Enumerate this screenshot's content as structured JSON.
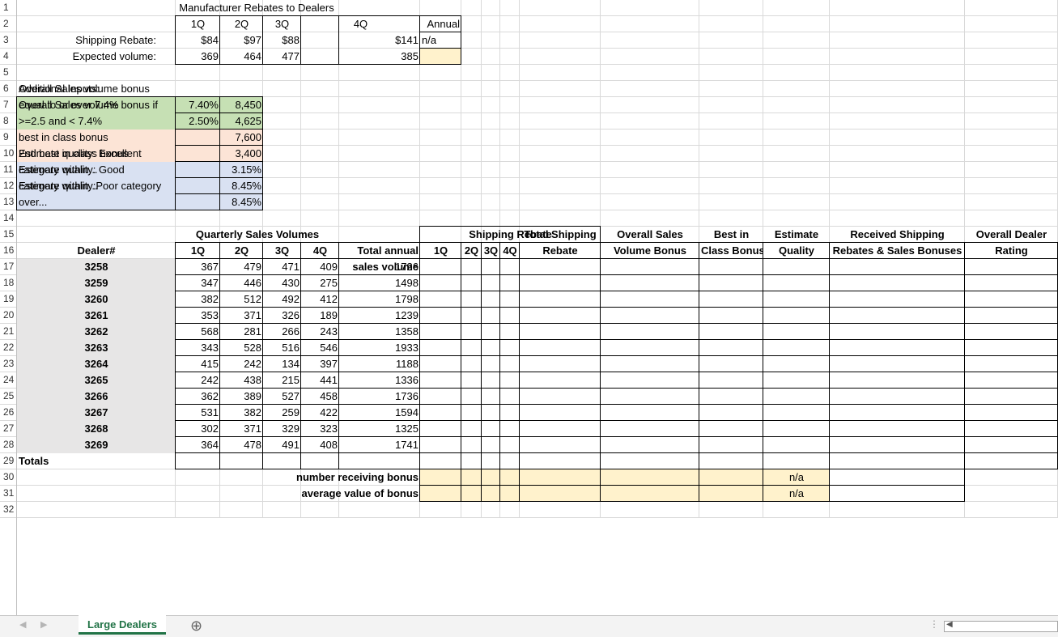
{
  "sheet": {
    "title": "Manufacturer Rebates to Dealers",
    "quarters": [
      "1Q",
      "2Q",
      "3Q",
      "4Q"
    ],
    "annual_label": "Annual",
    "shipping_rebate": {
      "label": "Shipping Rebate:",
      "values": [
        "$84",
        "$97",
        "$88",
        "$141"
      ],
      "annual": "n/a"
    },
    "expected_volume": {
      "label": "Expected volume:",
      "values": [
        "369",
        "464",
        "477",
        "385"
      ]
    },
    "additional_inputs_label": "Additional Inputs:",
    "inputs": [
      {
        "line1": "Overall Sales volume bonus",
        "line2": "equal to or over 7.4%",
        "pct": "7.40%",
        "value": "8,450"
      },
      {
        "line1": "Overall Sales volume bonus if",
        "line2": ">=2.5 and < 7.4%",
        "pct": "2.50%",
        "value": "4,625"
      },
      {
        "line1": "best in class bonus",
        "line2": "",
        "pct": "",
        "value": "7,600"
      },
      {
        "line1": "2nd best in class bonus",
        "line2": "",
        "pct": "",
        "value": "3,400"
      },
      {
        "line1": "Estimate quality: Excellent",
        "line2": "category within...",
        "pct": "",
        "value": "3.15%"
      },
      {
        "line1": "Estimate quality: Good",
        "line2": "category within...",
        "pct": "",
        "value": "8.45%"
      },
      {
        "line1": "Estimate quality:Poor category",
        "line2": "over...",
        "pct": "",
        "value": "8.45%"
      }
    ],
    "quarterly_sales_header": "Quarterly Sales Volumes",
    "shipping_rebate_header": "Shipping Rebate",
    "col_headers": {
      "dealer": "Dealer#",
      "total_annual_1": "Total annual",
      "total_annual_2": "sales volume",
      "total_ship_1": "Total Shipping",
      "total_ship_2": "Rebate",
      "overall_1": "Overall Sales",
      "overall_2": "Volume Bonus",
      "best_1": "Best in",
      "best_2": "Class Bonus",
      "quality_1": "Estimate",
      "quality_2": "Quality",
      "received_1": "Received Shipping",
      "received_2": "Rebates & Sales Bonuses",
      "rating_1": "Overall Dealer",
      "rating_2": "Rating"
    },
    "dealers": [
      {
        "id": "3258",
        "q": [
          "367",
          "479",
          "471",
          "409"
        ],
        "total": "1726"
      },
      {
        "id": "3259",
        "q": [
          "347",
          "446",
          "430",
          "275"
        ],
        "total": "1498"
      },
      {
        "id": "3260",
        "q": [
          "382",
          "512",
          "492",
          "412"
        ],
        "total": "1798"
      },
      {
        "id": "3261",
        "q": [
          "353",
          "371",
          "326",
          "189"
        ],
        "total": "1239"
      },
      {
        "id": "3262",
        "q": [
          "568",
          "281",
          "266",
          "243"
        ],
        "total": "1358"
      },
      {
        "id": "3263",
        "q": [
          "343",
          "528",
          "516",
          "546"
        ],
        "total": "1933"
      },
      {
        "id": "3264",
        "q": [
          "415",
          "242",
          "134",
          "397"
        ],
        "total": "1188"
      },
      {
        "id": "3265",
        "q": [
          "242",
          "438",
          "215",
          "441"
        ],
        "total": "1336"
      },
      {
        "id": "3266",
        "q": [
          "362",
          "389",
          "527",
          "458"
        ],
        "total": "1736"
      },
      {
        "id": "3267",
        "q": [
          "531",
          "382",
          "259",
          "422"
        ],
        "total": "1594"
      },
      {
        "id": "3268",
        "q": [
          "302",
          "371",
          "329",
          "323"
        ],
        "total": "1325"
      },
      {
        "id": "3269",
        "q": [
          "364",
          "478",
          "491",
          "408"
        ],
        "total": "1741"
      }
    ],
    "totals_label": "Totals",
    "number_receiving_label": "number receiving bonus",
    "average_value_label": "average value of bonus",
    "na": "n/a"
  },
  "row_numbers": [
    "1",
    "2",
    "3",
    "4",
    "5",
    "6",
    "7",
    "8",
    "9",
    "10",
    "11",
    "12",
    "13",
    "14",
    "15",
    "16",
    "17",
    "18",
    "19",
    "20",
    "21",
    "22",
    "23",
    "24",
    "25",
    "26",
    "27",
    "28",
    "29",
    "30",
    "31",
    "32"
  ],
  "tabs": {
    "active": "Large Dealers",
    "add_symbol": "⊕"
  },
  "colors": {
    "green_fill": "#c6e0b4",
    "peach_fill": "#fce4d6",
    "blue_fill": "#d9e1f2",
    "yellow_fill": "#fff2cc",
    "gray_fill": "#e7e6e6",
    "tab_green": "#217346"
  }
}
